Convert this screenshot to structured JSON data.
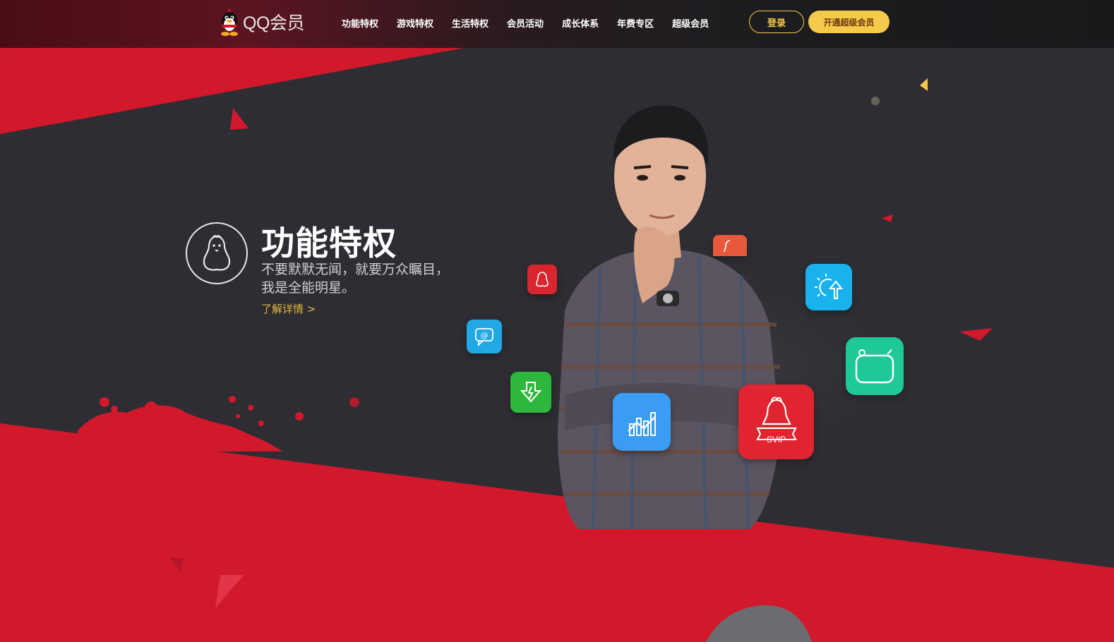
{
  "brand": {
    "name": "QQ会员"
  },
  "nav": {
    "items": [
      {
        "label": "功能特权"
      },
      {
        "label": "游戏特权"
      },
      {
        "label": "生活特权"
      },
      {
        "label": "会员活动"
      },
      {
        "label": "成长体系"
      },
      {
        "label": "年费专区"
      },
      {
        "label": "超级会员"
      }
    ],
    "login_label": "登录",
    "open_vip_label": "开通超级会员"
  },
  "hero": {
    "title": "功能特权",
    "desc_line1": "不要默默无闻，就要万众瞩目，",
    "desc_line2": "我是全能明星。",
    "more_link": "了解详情 >"
  },
  "icons": {
    "svip_text": "SVIP"
  },
  "colors": {
    "accent_red": "#d1192b",
    "dark_bg": "#2e2d33",
    "gold": "#f5c94a",
    "link_gold": "#e0b83f"
  }
}
